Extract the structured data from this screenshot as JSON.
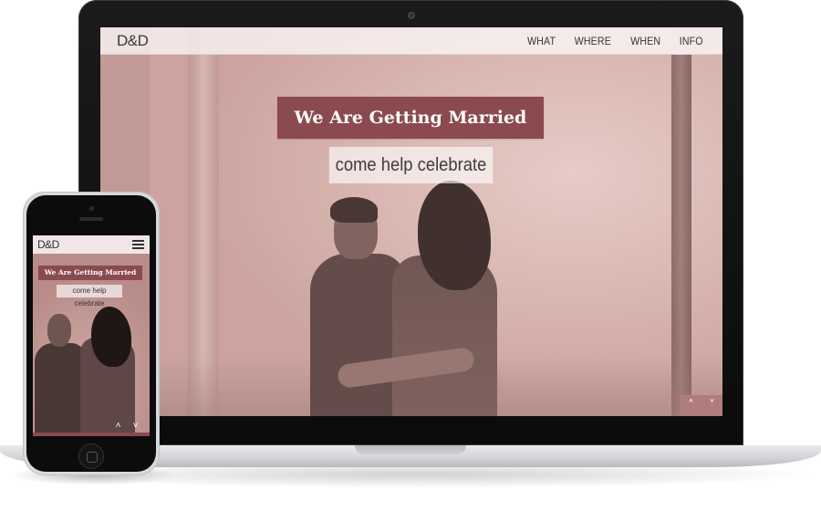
{
  "desktop": {
    "logo": "D&D",
    "nav": [
      "WHAT",
      "WHERE",
      "WHEN",
      "INFO"
    ],
    "hero_title": "We Are Getting Married",
    "hero_subtitle": "come help celebrate",
    "scroll_up": "^",
    "scroll_down": "⌄"
  },
  "mobile": {
    "logo": "D&D",
    "hero_title": "We Are Getting Married",
    "hero_subtitle": "come help celebrate",
    "scroll_up": "^",
    "scroll_down": "⌄"
  },
  "colors": {
    "accent": "#8a4a4f",
    "scroll_button_bg": "#b07d7f",
    "photo_tint": "#d8b6b3"
  },
  "icons": {
    "menu": "hamburger-icon",
    "up": "chevron-up-icon",
    "down": "chevron-down-icon"
  }
}
